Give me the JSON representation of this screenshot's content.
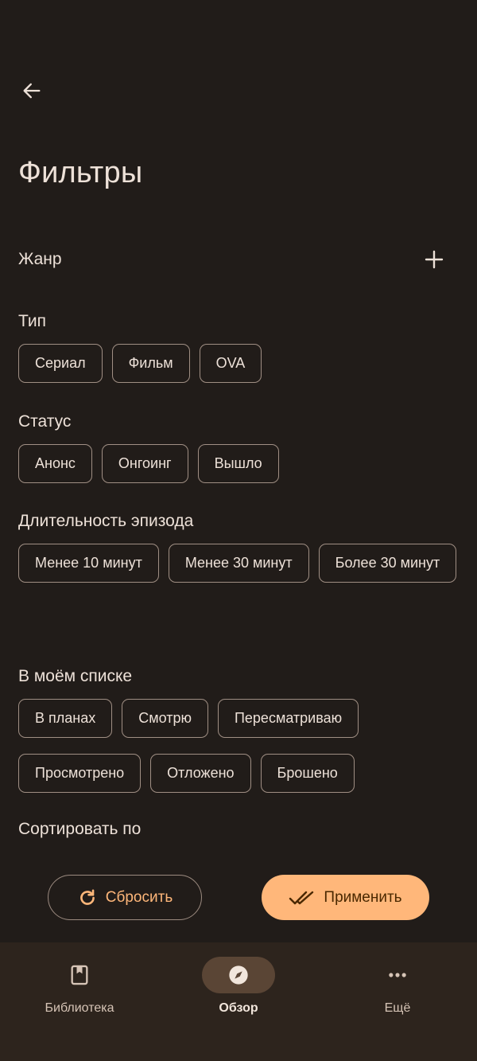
{
  "header": {
    "title": "Фильтры"
  },
  "genre": {
    "label": "Жанр"
  },
  "sections": {
    "type": {
      "label": "Тип",
      "chips": [
        "Сериал",
        "Фильм",
        "OVA"
      ]
    },
    "status": {
      "label": "Статус",
      "chips": [
        "Анонс",
        "Онгоинг",
        "Вышло"
      ]
    },
    "duration": {
      "label": "Длительность эпизода",
      "chips": [
        "Менее 10 минут",
        "Менее 30 минут",
        "Более 30 минут"
      ]
    },
    "my_list": {
      "label": "В моём списке",
      "chips": [
        "В планах",
        "Смотрю",
        "Пересматриваю",
        "Просмотрено",
        "Отложено",
        "Брошено"
      ]
    }
  },
  "sort": {
    "label": "Сортировать по"
  },
  "actions": {
    "reset_label": "Сбросить",
    "apply_label": "Применить"
  },
  "bottom_nav": {
    "items": [
      {
        "label": "Библиотека",
        "icon": "bookmark-book-icon",
        "active": false
      },
      {
        "label": "Обзор",
        "icon": "compass-icon",
        "active": true
      },
      {
        "label": "Ещё",
        "icon": "more-dots-icon",
        "active": false
      }
    ]
  },
  "colors": {
    "background": "#211c19",
    "accent": "#ffb77a",
    "chip_border": "#a08f84",
    "nav_background": "#2d241d",
    "nav_active_pill": "#5a4535"
  }
}
